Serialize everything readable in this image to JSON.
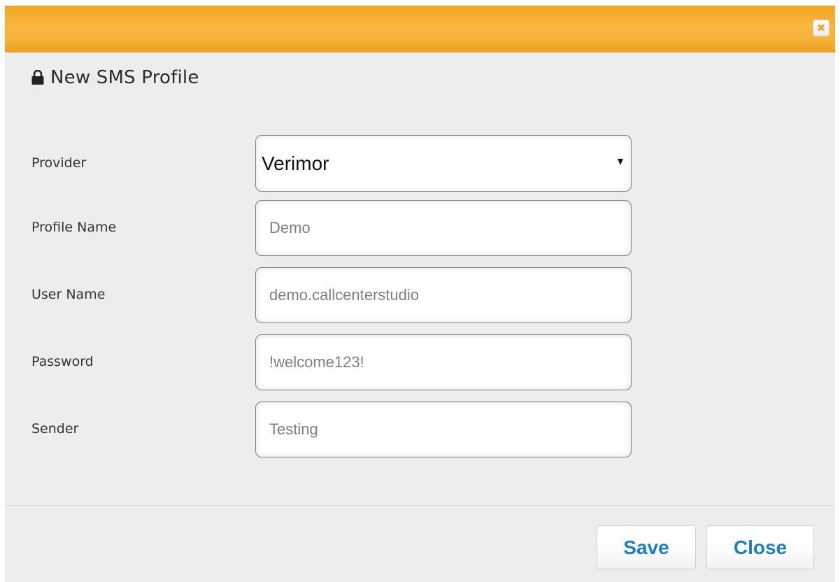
{
  "dialog": {
    "title": "New SMS Profile",
    "title_icon": "lock-icon",
    "close_icon": "close-icon",
    "close_glyph": "✖"
  },
  "form": {
    "provider": {
      "label": "Provider",
      "selected": "Verimor"
    },
    "profile_name": {
      "label": "Profile Name",
      "placeholder": "Demo"
    },
    "user_name": {
      "label": "User Name",
      "placeholder": "demo.callcenterstudio"
    },
    "password": {
      "label": "Password",
      "placeholder": "!welcome123!"
    },
    "sender": {
      "label": "Sender",
      "placeholder": "Testing"
    }
  },
  "footer": {
    "save_label": "Save",
    "close_label": "Close"
  },
  "colors": {
    "titlebar": "#f6b33b",
    "button_text": "#1d80b8",
    "dialog_background": "#ededed"
  }
}
